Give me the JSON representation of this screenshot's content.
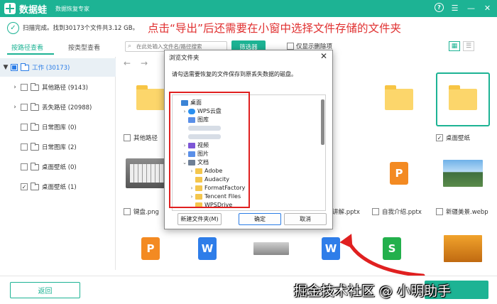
{
  "app": {
    "name": "数据蛙",
    "subtitle": "数据恢复专家"
  },
  "scan": {
    "status": "扫描完成。找到30173个文件共3.12 GB。"
  },
  "annotation": "点击“导出”后还需要在小窗中选择文件存储的文件夹",
  "tabs": [
    {
      "label": "按路径查看",
      "active": true
    },
    {
      "label": "按类型查看",
      "active": false
    }
  ],
  "search": {
    "placeholder": "在此处输入文件名/路径搜索"
  },
  "filter_label": "筛选器",
  "only_deleted_label": "仅显示删除项",
  "tree": [
    {
      "label": "工作 (30173)",
      "expand": "▼",
      "check": "partial",
      "root": true
    },
    {
      "label": "其他路径 (9143)",
      "expand": "›",
      "check": "none"
    },
    {
      "label": "丢失路径 (20988)",
      "expand": "›",
      "check": "none"
    },
    {
      "label": "日常图库 (0)",
      "expand": "",
      "check": "none"
    },
    {
      "label": "日常图库 (2)",
      "expand": "",
      "check": "none"
    },
    {
      "label": "桌面壁纸 (0)",
      "expand": "",
      "check": "none"
    },
    {
      "label": "桌面壁纸 (1)",
      "expand": "",
      "check": "checked"
    }
  ],
  "grid_labels": {
    "r1c1": "其他路径",
    "r1c6": "桌面壁纸",
    "r2c1": "键盘.png",
    "r2c4": "讲解.pptx",
    "r2c5": "自我介绍.pptx",
    "r2c6": "新疆美景.webp"
  },
  "dialog": {
    "title": "浏览文件夹",
    "description": "请勾选需要恢复的文件保存到原丢失数据的磁盘。",
    "tree": [
      {
        "label": "桌面",
        "icon": "ico-desktop",
        "exp": "",
        "indent": 0
      },
      {
        "label": "WPS云盘",
        "icon": "ico-cloud",
        "exp": "›",
        "indent": 1
      },
      {
        "label": "图库",
        "icon": "ico-pic",
        "exp": "",
        "indent": 1
      },
      {
        "label": "",
        "icon": "",
        "exp": "",
        "indent": 1,
        "blur": true
      },
      {
        "label": "",
        "icon": "",
        "exp": "",
        "indent": 1,
        "blur": true
      },
      {
        "label": "视频",
        "icon": "ico-video",
        "exp": "›",
        "indent": 1
      },
      {
        "label": "图片",
        "icon": "ico-pic",
        "exp": "›",
        "indent": 1
      },
      {
        "label": "文档",
        "icon": "ico-doc",
        "exp": "⌄",
        "indent": 1
      },
      {
        "label": "Adobe",
        "icon": "ico-folder",
        "exp": "›",
        "indent": 2
      },
      {
        "label": "Audacity",
        "icon": "ico-folder",
        "exp": "",
        "indent": 2
      },
      {
        "label": "FormatFactory",
        "icon": "ico-folder",
        "exp": "›",
        "indent": 2
      },
      {
        "label": "Tencent Files",
        "icon": "ico-folder",
        "exp": "›",
        "indent": 2
      },
      {
        "label": "WPSDrive",
        "icon": "ico-folder",
        "exp": "",
        "indent": 2
      }
    ],
    "new_folder": "新建文件夹(M)",
    "ok": "确定",
    "cancel": "取消"
  },
  "back_label": "返回",
  "watermark": "掘金技术社区 @ 小明助手",
  "colors": {
    "brand": "#1db394",
    "annotation": "#e03030",
    "highlight": "#e02020"
  }
}
